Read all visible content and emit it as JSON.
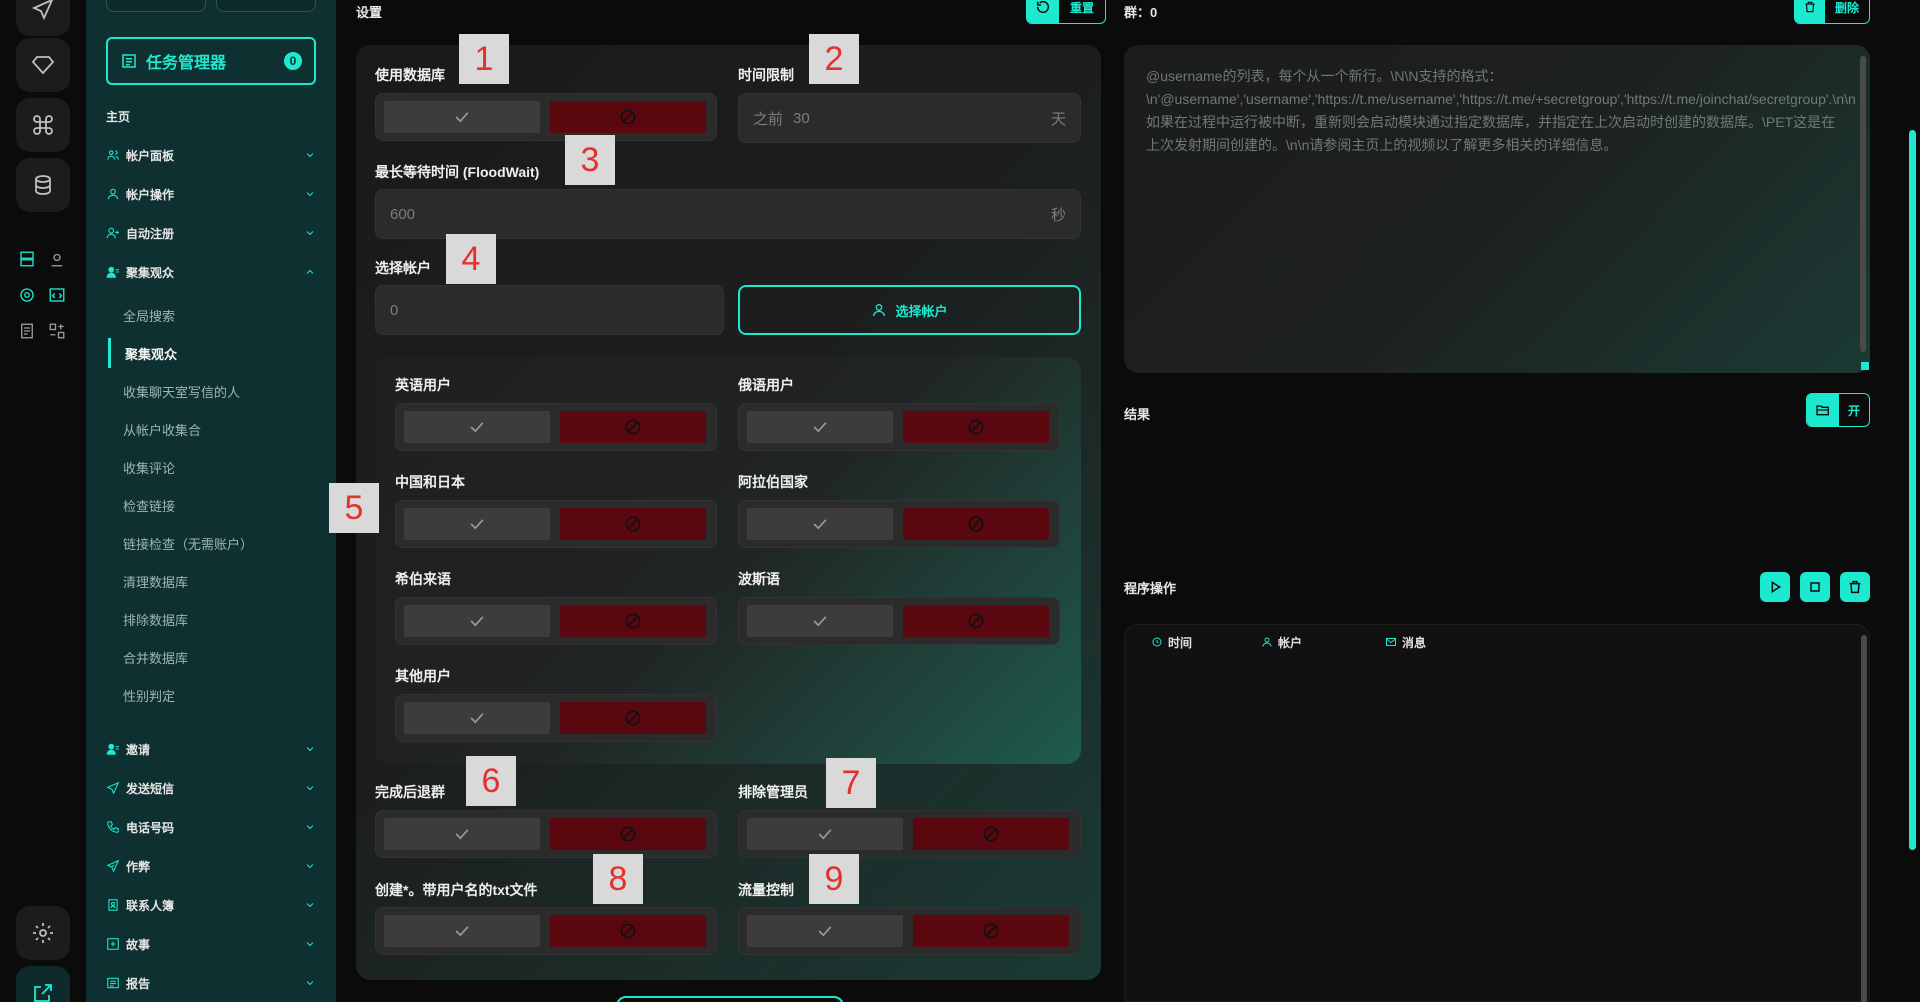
{
  "sidebar": {
    "task_manager_label": "任务管理器",
    "task_badge": "0",
    "home_label": "主页",
    "nav": [
      {
        "label": "帐户面板",
        "icon": "users-icon"
      },
      {
        "label": "帐户操作",
        "icon": "user-icon"
      },
      {
        "label": "自动注册",
        "icon": "user-plus-icon"
      },
      {
        "label": "聚集观众",
        "icon": "audience-icon"
      }
    ],
    "sub_items": [
      "全局搜索",
      "聚集观众",
      "收集聊天室写信的人",
      "从帐户收集合",
      "收集评论",
      "检查链接",
      "链接检查（无需账户）",
      "清理数据库",
      "排除数据库",
      "合并数据库",
      "性别判定"
    ],
    "active_sub": "聚集观众",
    "nav_bottom": [
      {
        "label": "邀请",
        "icon": "invite-icon"
      },
      {
        "label": "发送短信",
        "icon": "send-icon"
      },
      {
        "label": "电话号码",
        "icon": "phone-icon"
      },
      {
        "label": "作弊",
        "icon": "cheat-icon"
      },
      {
        "label": "联系人簿",
        "icon": "contacts-icon"
      },
      {
        "label": "故事",
        "icon": "story-icon"
      },
      {
        "label": "报告",
        "icon": "report-icon"
      }
    ]
  },
  "settings": {
    "title": "设置",
    "reset_label": "重置",
    "use_db_label": "使用数据库",
    "time_limit_label": "时间限制",
    "time_limit_prefix": "之前",
    "time_limit_value": "30",
    "time_limit_unit": "天",
    "flood_wait_label": "最长等待时间 (FloodWait)",
    "flood_wait_value": "600",
    "flood_wait_unit": "秒",
    "select_account_label": "选择帐户",
    "select_account_value": "0",
    "select_account_button": "选择帐户",
    "langs": {
      "english": "英语用户",
      "russian": "俄语用户",
      "cn_jp": "中国和日本",
      "arab": "阿拉伯国家",
      "hebrew": "希伯来语",
      "persian": "波斯语",
      "other": "其他用户"
    },
    "leave_after_label": "完成后退群",
    "exclude_admin_label": "排除管理员",
    "create_txt_label": "创建*。带用户名的txt文件",
    "flow_control_label": "流量控制"
  },
  "badges": [
    "1",
    "2",
    "3",
    "4",
    "5",
    "6",
    "7",
    "8",
    "9"
  ],
  "right": {
    "groups_label": "群：0",
    "delete_label": "删除",
    "textarea_placeholder": "@username的列表，每个从一个新行。\\N\\N支持的格式：\\n'@username','username','https://t.me/username','https://t.me/+secretgroup','https://t.me/joinchat/secretgroup'.\\n\\n如果在过程中运行被中断，重新则会启动模块通过指定数据库，并指定在上次启动时创建的数据库。\\PET这是在上次发射期间创建的。\\n\\n请参阅主页上的视频以了解更多相关的详细信息。",
    "results_label": "结果",
    "open_label": "开",
    "ops_label": "程序操作",
    "log_columns": [
      "时间",
      "帐户",
      "消息"
    ]
  },
  "colors": {
    "accent": "#1de9d0",
    "deny": "#5a0710",
    "sidebar_bg": "#0f3030"
  }
}
